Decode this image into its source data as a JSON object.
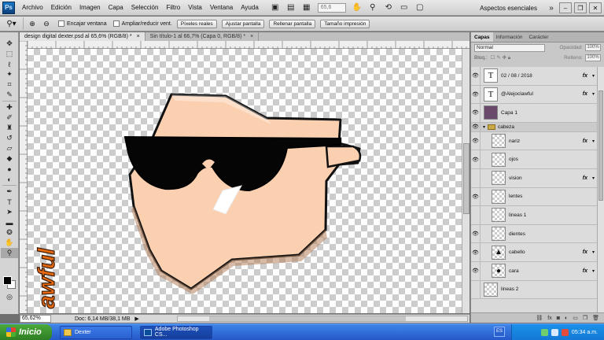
{
  "app": {
    "logo_text": "Ps"
  },
  "menu": [
    "Archivo",
    "Edición",
    "Imagen",
    "Capa",
    "Selección",
    "Filtro",
    "Vista",
    "Ventana",
    "Ayuda"
  ],
  "menubar_right": {
    "zoom_value": "65,6",
    "workspace": "Aspectos esenciales"
  },
  "options_bar": {
    "checkbox_fit_window": "Encajar ventana",
    "checkbox_resize": "Ampliar/reducir vent.",
    "buttons": [
      "Píxeles reales",
      "Ajustar pantalla",
      "Rellenar pantalla",
      "Tamaño impresión"
    ]
  },
  "doc_tabs": [
    {
      "label": "design digital dexter.psd al 65,6% (RGB/8) *",
      "active": true
    },
    {
      "label": "Sin título-1 al 66,7% (Capa 0, RGB/8) *",
      "active": false
    }
  ],
  "status_bar": {
    "zoom": "65,62%",
    "doc_info": "Doc: 6,14 MB/38,1 MB"
  },
  "canvas": {
    "signature_text": "awful"
  },
  "panels": {
    "tabs": [
      "Capas",
      "Información",
      "Carácter"
    ],
    "blend_mode": "Normal",
    "opacity_label": "Opacidad:",
    "opacity_value": "100%",
    "lock_label": "Bloq.:",
    "fill_label": "Relleno:",
    "fill_value": "100%",
    "layers": [
      {
        "name": "02 / 08 / 2018",
        "kind": "text",
        "visible": true,
        "fx": true
      },
      {
        "name": "@Alejoclawful",
        "kind": "text",
        "visible": true,
        "fx": true
      },
      {
        "name": "Capa 1",
        "kind": "pixel",
        "visible": true,
        "fx": false
      },
      {
        "name": "cabeza",
        "kind": "group",
        "visible": true,
        "fx": false
      },
      {
        "name": "nariz",
        "kind": "pixel",
        "visible": true,
        "fx": true,
        "indent": true
      },
      {
        "name": "ojos",
        "kind": "pixel",
        "visible": true,
        "fx": false,
        "indent": true
      },
      {
        "name": "vision",
        "kind": "pixel",
        "visible": false,
        "fx": true,
        "indent": true
      },
      {
        "name": "lentes",
        "kind": "pixel",
        "visible": true,
        "fx": false,
        "indent": true
      },
      {
        "name": "lineas 1",
        "kind": "pixel",
        "visible": false,
        "fx": false,
        "indent": true
      },
      {
        "name": "dientes",
        "kind": "pixel",
        "visible": true,
        "fx": false,
        "indent": true
      },
      {
        "name": "cabello",
        "kind": "pixel",
        "visible": true,
        "fx": true,
        "indent": true
      },
      {
        "name": "cara",
        "kind": "pixel",
        "visible": true,
        "fx": true,
        "indent": true
      },
      {
        "name": "lineas 2",
        "kind": "pixel",
        "visible": false,
        "fx": false,
        "indent": false
      }
    ]
  },
  "taskbar": {
    "start_label": "Inicio",
    "tasks": [
      "Dexter",
      "Adobe Photoshop CS..."
    ],
    "lang": "ES",
    "clock": "05:34 a.m."
  }
}
